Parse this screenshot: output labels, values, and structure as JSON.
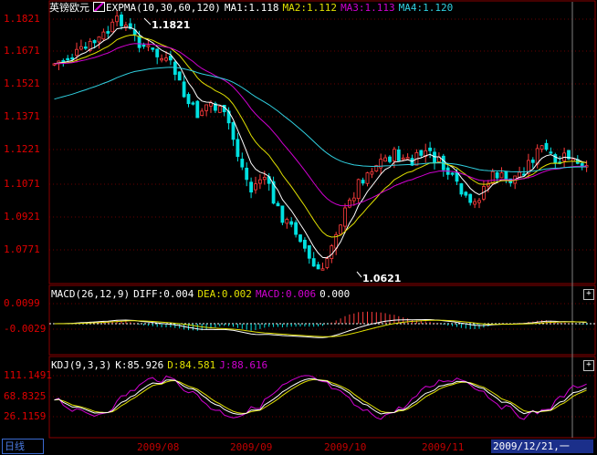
{
  "main": {
    "symbol": "英镑欧元",
    "indicator": "EXPMA(10,30,60,120)",
    "ma1": "MA1:1.118",
    "ma2": "MA2:1.112",
    "ma3": "MA3:1.113",
    "ma4": "MA4:1.120",
    "y_ticks": [
      "1.1821",
      "1.1671",
      "1.1521",
      "1.1371",
      "1.1221",
      "1.1071",
      "1.0921",
      "1.0771"
    ],
    "high_label": "1.1821",
    "low_label": "1.0621"
  },
  "macd": {
    "title": "MACD(26,12,9)",
    "diff": "DIFF:0.004",
    "dea": "DEA:0.002",
    "macd": "MACD:0.006",
    "extra": "0.000",
    "y_ticks": [
      "0.0099",
      "-0.0029"
    ]
  },
  "kdj": {
    "title": "KDJ(9,3,3)",
    "k": "K:85.926",
    "d": "D:84.581",
    "j": "J:88.616",
    "y_ticks": [
      "111.1491",
      "68.8325",
      "26.1159"
    ]
  },
  "x_axis": {
    "tab_label": "日线",
    "ticks": [
      "2009/08",
      "2009/09",
      "2009/10",
      "2009/11"
    ],
    "cursor_date": "2009/12/21,一"
  },
  "colors": {
    "bg": "#000000",
    "frame": "#8a0000",
    "up": "#ff3c3c",
    "down": "#00e0e0",
    "ma1": "#ffffff",
    "ma2": "#e0e000",
    "ma3": "#d000d0",
    "ma4": "#30d0e0"
  },
  "plus_icon": "plus-icon"
}
